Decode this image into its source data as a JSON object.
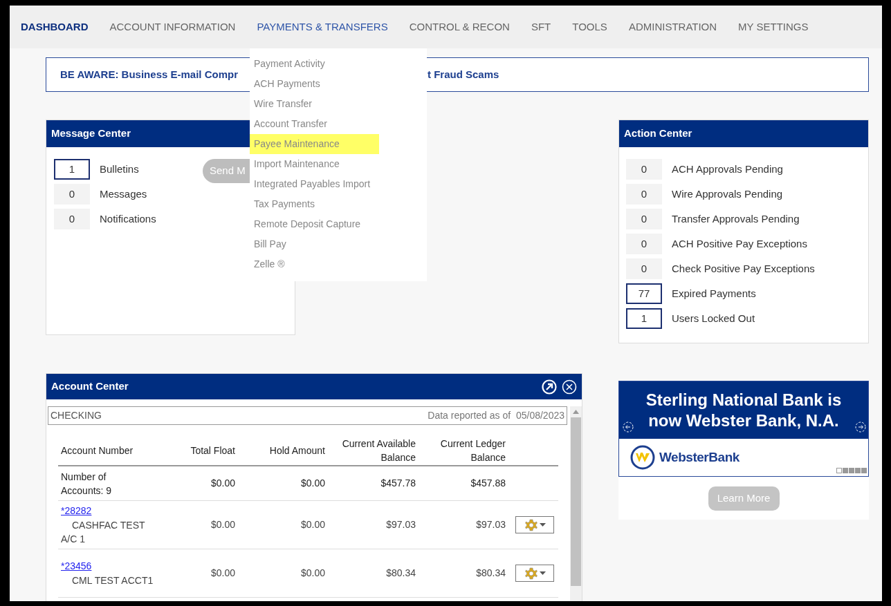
{
  "nav": [
    {
      "label": "DASHBOARD",
      "selected": true,
      "open": false
    },
    {
      "label": "ACCOUNT INFORMATION",
      "selected": false,
      "open": false
    },
    {
      "label": "PAYMENTS & TRANSFERS",
      "selected": false,
      "open": true
    },
    {
      "label": "CONTROL & RECON",
      "selected": false,
      "open": false
    },
    {
      "label": "SFT",
      "selected": false,
      "open": false
    },
    {
      "label": "TOOLS",
      "selected": false,
      "open": false
    },
    {
      "label": "ADMINISTRATION",
      "selected": false,
      "open": false
    },
    {
      "label": "MY SETTINGS",
      "selected": false,
      "open": false
    }
  ],
  "dropdown": [
    {
      "label": "Payment Activity",
      "selected": false
    },
    {
      "label": "ACH Payments",
      "selected": false
    },
    {
      "label": "Wire Transfer",
      "selected": false
    },
    {
      "label": "Account Transfer",
      "selected": false
    },
    {
      "label": "Payee Maintenance",
      "selected": true
    },
    {
      "label": "Import Maintenance",
      "selected": false
    },
    {
      "label": "Integrated Payables Import",
      "selected": false
    },
    {
      "label": "Tax Payments",
      "selected": false
    },
    {
      "label": "Remote Deposit Capture",
      "selected": false
    },
    {
      "label": "Bill Pay",
      "selected": false
    },
    {
      "label": "Zelle ®",
      "selected": false
    }
  ],
  "alert_banner": {
    "text_start": "BE AWARE: Business E-mail Compr",
    "text_end": "t Fraud Scams"
  },
  "message_center": {
    "title": "Message Center",
    "send_button": "Send M",
    "items": [
      {
        "count": "1",
        "label": "Bulletins",
        "flagged": true
      },
      {
        "count": "0",
        "label": "Messages",
        "flagged": false
      },
      {
        "count": "0",
        "label": "Notifications",
        "flagged": false
      }
    ]
  },
  "action_center": {
    "title": "Action Center",
    "items": [
      {
        "count": "0",
        "label": "ACH Approvals Pending",
        "flagged": false
      },
      {
        "count": "0",
        "label": "Wire Approvals Pending",
        "flagged": false
      },
      {
        "count": "0",
        "label": "Transfer Approvals Pending",
        "flagged": false
      },
      {
        "count": "0",
        "label": "ACH Positive Pay Exceptions",
        "flagged": false
      },
      {
        "count": "0",
        "label": "Check Positive Pay Exceptions",
        "flagged": false
      },
      {
        "count": "77",
        "label": "Expired Payments",
        "flagged": true
      },
      {
        "count": "1",
        "label": "Users Locked Out",
        "flagged": true
      }
    ]
  },
  "account_center": {
    "title": "Account Center",
    "section": "CHECKING",
    "reported": "Data reported as of  05/08/2023",
    "columns": [
      "Account Number",
      "Total Float",
      "Hold Amount",
      "Current Available Balance",
      "Current Ledger Balance"
    ],
    "rows": [
      {
        "kind": "summary",
        "account": "Number of Accounts: 9",
        "total_float": "$0.00",
        "hold_amount": "$0.00",
        "available": "$457.78",
        "ledger": "$457.88"
      },
      {
        "kind": "account",
        "number": "*28282",
        "account": "CASHFAC TEST A/C 1",
        "total_float": "$0.00",
        "hold_amount": "$0.00",
        "available": "$97.03",
        "ledger": "$97.03"
      },
      {
        "kind": "account",
        "number": "*23456",
        "account": "CML TEST ACCT1",
        "total_float": "$0.00",
        "hold_amount": "$0.00",
        "available": "$80.34",
        "ledger": "$80.34"
      }
    ]
  },
  "promo": {
    "headline": "Sterling National Bank is now Webster Bank, N.A.",
    "brand": "WebsterBank",
    "slides": [
      {
        "selected": true
      },
      {
        "selected": false
      },
      {
        "selected": false
      },
      {
        "selected": false
      },
      {
        "selected": false
      }
    ],
    "button": "Learn More"
  }
}
